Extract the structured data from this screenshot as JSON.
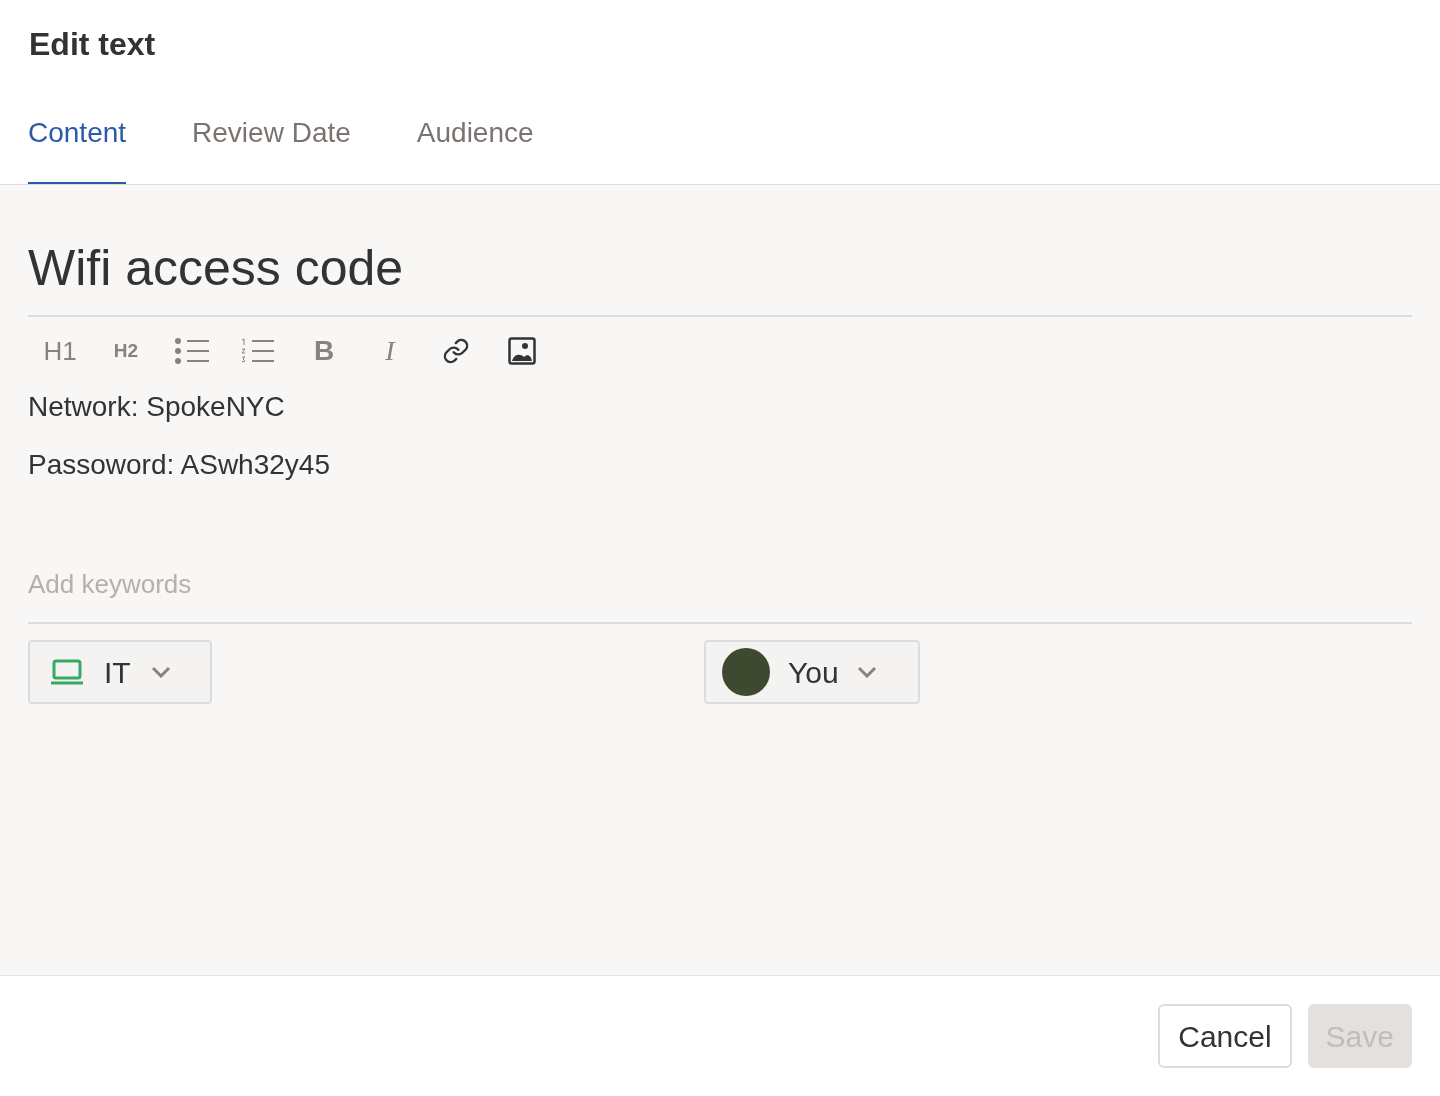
{
  "dialog": {
    "title": "Edit text"
  },
  "tabs": [
    {
      "label": "Content",
      "selected": true
    },
    {
      "label": "Review Date",
      "selected": false
    },
    {
      "label": "Audience",
      "selected": false
    }
  ],
  "editor": {
    "title": "Wifi access code",
    "toolbar": [
      {
        "kind": "h1",
        "label": "H1"
      },
      {
        "kind": "h2",
        "label": "H2"
      },
      {
        "kind": "bullets"
      },
      {
        "kind": "numbers"
      },
      {
        "kind": "bold",
        "label": "B"
      },
      {
        "kind": "italic",
        "label": "I"
      },
      {
        "kind": "link"
      },
      {
        "kind": "image"
      }
    ],
    "paragraphs": [
      "Network: SpokeNYC",
      "Passoword: ASwh32y45"
    ],
    "keywords": {
      "placeholder": "Add keywords"
    }
  },
  "category": {
    "label": "IT"
  },
  "owner": {
    "label": "You"
  },
  "buttons": [
    {
      "label": "Cancel",
      "disabled": false
    },
    {
      "label": "Save",
      "disabled": true
    }
  ]
}
